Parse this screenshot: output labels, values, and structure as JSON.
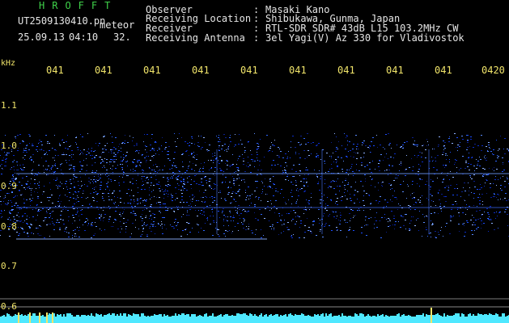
{
  "header": {
    "app_title": "HROFFT",
    "file_name": "UT2509130410.pn",
    "file_kind": "meteor",
    "capture_date": "25.09.13",
    "capture_time": "04:10",
    "capture_value": "32."
  },
  "station_info": [
    {
      "label": "Observer",
      "value": "Masaki Kano"
    },
    {
      "label": "Receiving Location",
      "value": "Shibukawa, Gunma, Japan"
    },
    {
      "label": "Receiver",
      "value": "RTL-SDR SDR# 43dB L15 103.2MHz CW"
    },
    {
      "label": "Receiving Antenna",
      "value": "3el Yagi(V) Az 330 for Vladivostok"
    }
  ],
  "separator": ":",
  "spectrogram": {
    "unit_label": "kHz",
    "time_labels": [
      "041",
      "041",
      "041",
      "041",
      "041",
      "041",
      "041",
      "041",
      "041",
      "0420"
    ],
    "freq_labels": [
      "1.1",
      "1.0",
      "0.9",
      "0.8",
      "0.7",
      "0.6"
    ],
    "colors": {
      "label": "#f0e46a",
      "noise_floor": "#1a4dff",
      "baseline": "#4fe8ff",
      "spike": "#f0e46a"
    }
  }
}
